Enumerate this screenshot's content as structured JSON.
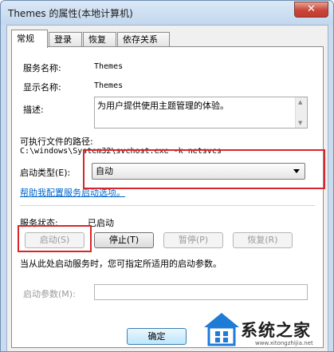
{
  "window": {
    "title": "Themes 的属性(本地计算机)",
    "close_glyph": "✕"
  },
  "tabs": [
    {
      "label": "常规",
      "active": true
    },
    {
      "label": "登录",
      "active": false
    },
    {
      "label": "恢复",
      "active": false
    },
    {
      "label": "依存关系",
      "active": false
    }
  ],
  "general": {
    "service_name_label": "服务名称:",
    "service_name_value": "Themes",
    "display_name_label": "显示名称:",
    "display_name_value": "Themes",
    "description_label": "描述:",
    "description_value": "为用户提供使用主题管理的体验。",
    "exe_path_label": "可执行文件的路径:",
    "exe_path_value": "C:\\windows\\System32\\svchost.exe -k netsvcs",
    "startup_type_label": "启动类型(E):",
    "startup_type_value": "自动",
    "help_link": "帮助我配置服务启动选项。",
    "service_status_label": "服务状态:",
    "service_status_value": "已启动",
    "buttons": {
      "start": "启动(S)",
      "stop": "停止(T)",
      "pause": "暂停(P)",
      "resume": "恢复(R)"
    },
    "start_params_hint": "当从此处启动服务时，您可指定所适用的启动参数。",
    "start_params_label": "启动参数(M):",
    "start_params_value": ""
  },
  "footer": {
    "ok": "确定"
  },
  "watermark": {
    "text": "系统之家",
    "url": "www.xitongzhijia.net"
  },
  "colors": {
    "highlight": "#d8262a",
    "link": "#0066cc",
    "titlebar": "#c9dcef"
  }
}
